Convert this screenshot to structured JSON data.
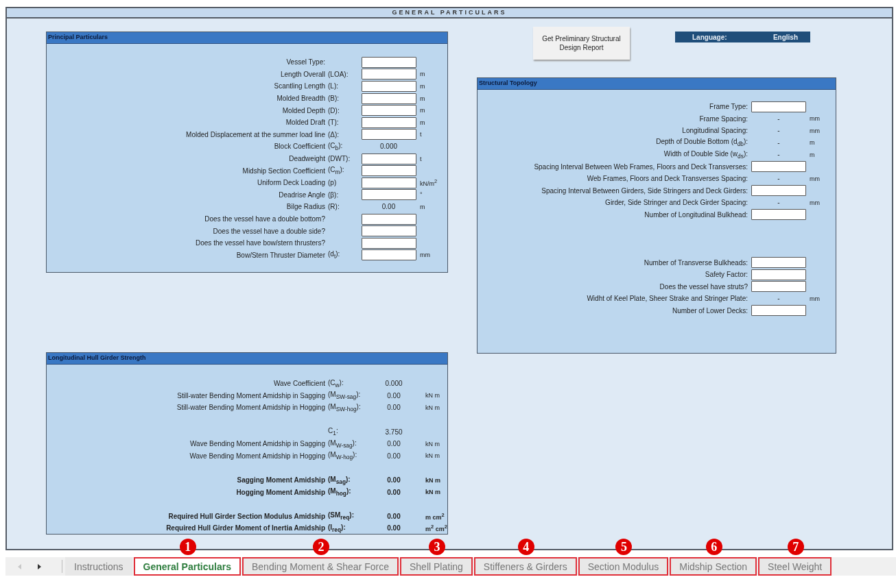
{
  "sheet_title": "GENERAL PARTICULARS",
  "report_button": "Get Preliminary Structural Design Report",
  "language": {
    "label": "Language:",
    "value": "English"
  },
  "principal": {
    "title": "Principal Particulars",
    "rows": [
      {
        "kind": "input",
        "label": "Vessel Type:"
      },
      {
        "kind": "input",
        "label": "Length Overall",
        "symbol": "(LOA):",
        "unit": "m"
      },
      {
        "kind": "input",
        "label": "Scantling Length",
        "symbol": "(L):",
        "unit": "m"
      },
      {
        "kind": "input",
        "label": "Molded Breadth",
        "symbol": "(B):",
        "unit": "m"
      },
      {
        "kind": "input",
        "label": "Molded Depth",
        "symbol": "(D):",
        "unit": "m"
      },
      {
        "kind": "input",
        "label": "Molded Draft",
        "symbol": "(T):",
        "unit": "m"
      },
      {
        "kind": "input",
        "label": "Molded Displacement at the summer load line",
        "symbol": "(Δ):",
        "unit": "t"
      },
      {
        "kind": "value",
        "label": "Block Coefficient",
        "symbol": "(C$_{b}$):",
        "value": "0.000"
      },
      {
        "kind": "input",
        "label": "Deadweight",
        "symbol": "(DWT):",
        "unit": "t"
      },
      {
        "kind": "input",
        "label": "Midship Section Coefficient",
        "symbol": "(C$_{m}$):"
      },
      {
        "kind": "input",
        "label": "Uniform Deck Loading",
        "symbol": "(p)",
        "unit": "kN/m$^{2}$"
      },
      {
        "kind": "input",
        "label": "Deadrise Angle",
        "symbol": "(β):",
        "unit": "°"
      },
      {
        "kind": "value",
        "label": "Bilge Radius",
        "symbol": "(R):",
        "value": "0.00",
        "unit": "m"
      },
      {
        "kind": "input",
        "label": "Does the vessel have a double bottom?"
      },
      {
        "kind": "input",
        "label": "Does the vessel have a double side?"
      },
      {
        "kind": "input",
        "label": "Does the vessel have bow/stern thrusters?"
      },
      {
        "kind": "input",
        "label": "Bow/Stern Thruster Diameter",
        "symbol": "(d$_{t}$):",
        "unit": "mm"
      }
    ]
  },
  "hull_girder": {
    "title": "Longitudinal Hull Girder Strength",
    "rows": [
      {
        "kind": "value",
        "label": "Wave Coefficient",
        "symbol": "(C$_{w}$):",
        "value": "0.000"
      },
      {
        "kind": "value",
        "label": "Still-water Bending Moment Amidship in Sagging",
        "symbol": "(M$_{SW-sag}$):",
        "value": "0.00",
        "unit": "kN m"
      },
      {
        "kind": "value",
        "label": "Still-water Bending Moment Amidship in Hogging",
        "symbol": "(M$_{SW-hog}$):",
        "value": "0.00",
        "unit": "kN m"
      },
      {
        "kind": "gap"
      },
      {
        "kind": "value",
        "symbol": "C$_{1}$:",
        "value": "3.750"
      },
      {
        "kind": "value",
        "label": "Wave Bending Moment Amidship in Sagging",
        "symbol": "(M$_{W-sag}$):",
        "value": "0.00",
        "unit": "kN m"
      },
      {
        "kind": "value",
        "label": "Wave Bending Moment Amidship in Hogging",
        "symbol": "(M$_{W-hog}$):",
        "value": "0.00",
        "unit": "kN m"
      },
      {
        "kind": "gap"
      },
      {
        "kind": "value",
        "bold": true,
        "label": "Sagging Moment Amidship",
        "symbol": "(M$_{sag}$):",
        "value": "0.00",
        "unit": "kN m"
      },
      {
        "kind": "value",
        "bold": true,
        "label": "Hogging Moment Amidship",
        "symbol": "(M$_{hog}$):",
        "value": "0.00",
        "unit": "kN m"
      },
      {
        "kind": "gap"
      },
      {
        "kind": "value",
        "bold": true,
        "label": "Required Hull Girder Section Modulus Amidship",
        "symbol": "(SM$_{req}$):",
        "value": "0.00",
        "unit": "m cm$^{2}$"
      },
      {
        "kind": "value",
        "bold": true,
        "label": "Required Hull Girder Moment of Inertia Amidship",
        "symbol": "(I$_{req}$):",
        "value": "0.00",
        "unit": "m$^{2}$ cm$^{2}$"
      }
    ]
  },
  "topology": {
    "title": "Structural Topology",
    "rows": [
      {
        "kind": "input",
        "label": "Frame Type:"
      },
      {
        "kind": "value",
        "label": "Frame Spacing:",
        "value": "-",
        "unit": "mm"
      },
      {
        "kind": "value",
        "label": "Longitudinal Spacing:",
        "value": "-",
        "unit": "mm"
      },
      {
        "kind": "value",
        "label": "Depth of Double Bottom (d$_{db}$):",
        "value": "-",
        "unit": "m"
      },
      {
        "kind": "value",
        "label": "Width of Double Side (w$_{ds}$):",
        "value": "-",
        "unit": "m"
      },
      {
        "kind": "input",
        "label": "Spacing Interval Between Web Frames, Floors and Deck Transverses:"
      },
      {
        "kind": "value",
        "label": "Web Frames, Floors and Deck Transverses Spacing:",
        "value": "-",
        "unit": "mm"
      },
      {
        "kind": "input",
        "label": "Spacing Interval Between Girders, Side Stringers and Deck Girders:"
      },
      {
        "kind": "value",
        "label": "Girder, Side Stringer and Deck Girder Spacing:",
        "value": "-",
        "unit": "mm"
      },
      {
        "kind": "input",
        "label": "Number of Longitudinal Bulkhead:"
      },
      {
        "kind": "gap"
      },
      {
        "kind": "gap"
      },
      {
        "kind": "gap"
      },
      {
        "kind": "input",
        "label": "Number of Transverse Bulkheads:"
      },
      {
        "kind": "input",
        "label": "Safety Factor:"
      },
      {
        "kind": "input",
        "label": "Does the vessel have struts?"
      },
      {
        "kind": "value",
        "label": "Widht of Keel Plate, Sheer Strake and Stringer Plate:",
        "value": "-",
        "unit": "mm"
      },
      {
        "kind": "input",
        "label": "Number of Lower Decks:"
      }
    ]
  },
  "sheet_tabs": [
    {
      "label": "Instructions",
      "selected": false
    },
    {
      "label": "General Particulars",
      "selected": true,
      "badge": "1"
    },
    {
      "label": "Bending Moment & Shear Force",
      "selected": false,
      "badge": "2"
    },
    {
      "label": "Shell Plating",
      "selected": false,
      "badge": "3"
    },
    {
      "label": "Stiffeners & Girders",
      "selected": false,
      "badge": "4"
    },
    {
      "label": "Section Modulus",
      "selected": false,
      "badge": "5"
    },
    {
      "label": "Midship Section",
      "selected": false,
      "badge": "6"
    },
    {
      "label": "Steel Weight",
      "selected": false,
      "badge": "7"
    }
  ]
}
